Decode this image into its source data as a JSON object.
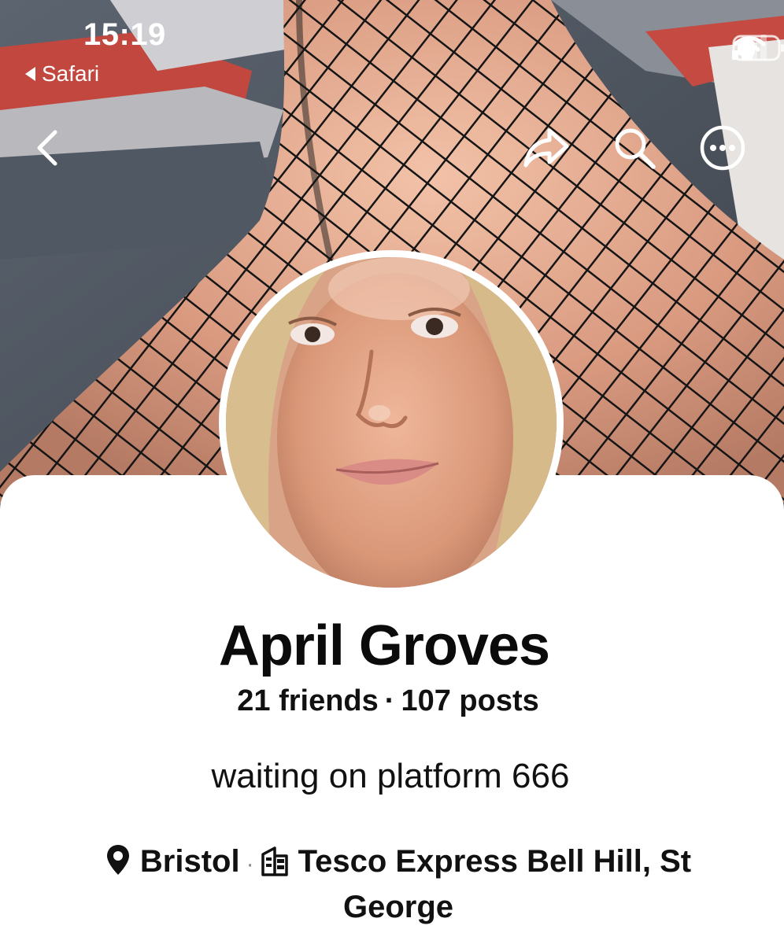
{
  "status_bar": {
    "time": "15:19",
    "back_app": "Safari",
    "cellular_icon": "cellular-signal-icon",
    "wifi_icon": "wifi-icon",
    "battery_icon": "battery-icon"
  },
  "top_bar": {
    "back_icon": "chevron-left-icon",
    "share_icon": "share-icon",
    "search_icon": "search-icon",
    "more_icon": "more-options-icon"
  },
  "profile": {
    "name": "April Groves",
    "friends": "21 friends",
    "separator": "·",
    "posts": "107 posts",
    "bio": "waiting on platform 666",
    "location_icon": "map-pin-icon",
    "location": "Bristol",
    "detail_separator": "·",
    "workplace_icon": "building-icon",
    "workplace": "Tesco Express Bell Hill, St George"
  },
  "colors": {
    "card_background": "#ffffff",
    "text_primary": "#111111",
    "overlay_icons": "#ffffff"
  }
}
